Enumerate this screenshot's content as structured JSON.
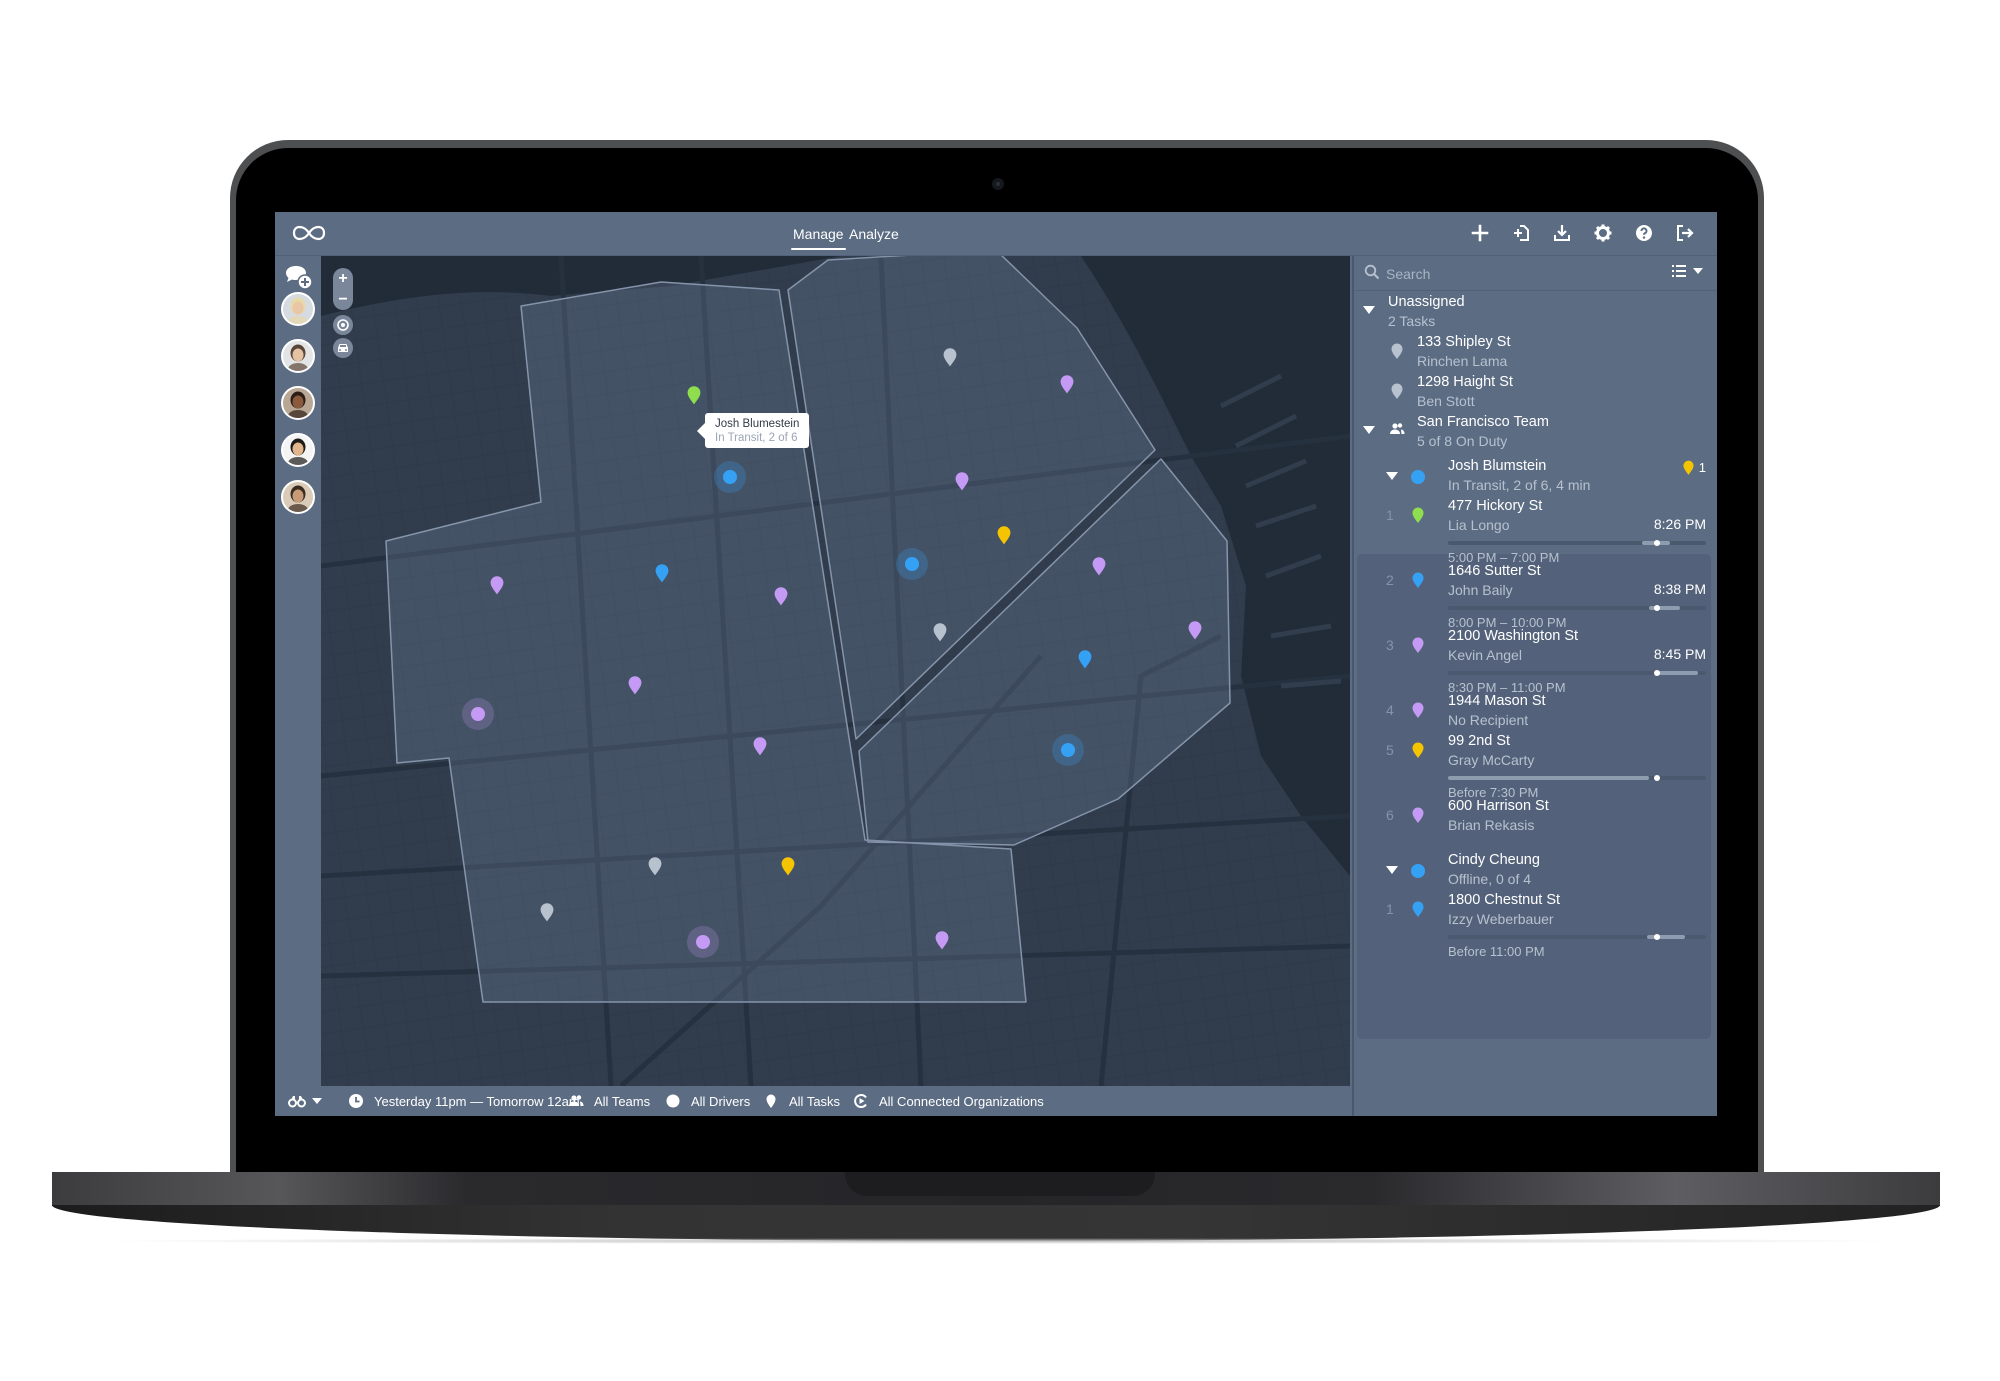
{
  "app": {
    "logo_icon": "infinity-icon",
    "nav_tabs": [
      {
        "label": "Manage",
        "active": true
      },
      {
        "label": "Analyze",
        "active": false
      }
    ],
    "top_actions": [
      {
        "name": "add-task-button",
        "icon": "plus-icon"
      },
      {
        "name": "import-button",
        "icon": "import-icon"
      },
      {
        "name": "download-button",
        "icon": "download-icon"
      },
      {
        "name": "settings-button",
        "icon": "gear-icon"
      },
      {
        "name": "help-button",
        "icon": "question-icon"
      },
      {
        "name": "logout-button",
        "icon": "logout-icon"
      }
    ]
  },
  "leftbar": {
    "chat_icon": "chat-add-icon",
    "avatars": [
      {
        "name": "driver-avatar-1",
        "skin": "#e9c6a6",
        "hair": "#e8d9a8",
        "bg": "#d5dbe0"
      },
      {
        "name": "driver-avatar-2",
        "skin": "#e6c2a4",
        "hair": "#5a4636",
        "bg": "#e3e4e6"
      },
      {
        "name": "driver-avatar-3",
        "skin": "#8a5a3e",
        "hair": "#2c1d15",
        "bg": "#b8a794"
      },
      {
        "name": "driver-avatar-4",
        "skin": "#e2b68c",
        "hair": "#1d1a17",
        "bg": "#f4f4f4"
      },
      {
        "name": "driver-avatar-5",
        "skin": "#c79a78",
        "hair": "#3b2a20",
        "bg": "#d9cbb8"
      }
    ]
  },
  "map": {
    "controls": {
      "zoom_in": "+",
      "zoom_out": "−",
      "locate_icon": "target-icon",
      "vehicle_icon": "car-icon"
    },
    "tooltip": {
      "name": "Josh Blumestein",
      "status": "In Transit, 2 of 6"
    },
    "colors": {
      "blue": "#35a1f5",
      "purple": "#c49af5",
      "green": "#8fde4e",
      "yellow": "#f5c400",
      "gray": "#b8c2cf"
    },
    "pins": [
      {
        "type": "pin",
        "color": "gray"
      },
      {
        "type": "pin",
        "color": "purple"
      },
      {
        "type": "pin",
        "color": "green"
      },
      {
        "type": "driver",
        "color": "blue"
      },
      {
        "type": "pin",
        "color": "purple"
      },
      {
        "type": "pin",
        "color": "yellow"
      },
      {
        "type": "driver",
        "color": "blue"
      },
      {
        "type": "pin",
        "color": "purple"
      },
      {
        "type": "pin",
        "color": "purple"
      },
      {
        "type": "pin",
        "color": "blue"
      },
      {
        "type": "pin",
        "color": "purple"
      },
      {
        "type": "pin",
        "color": "gray"
      },
      {
        "type": "pin",
        "color": "purple"
      },
      {
        "type": "pin",
        "color": "blue"
      },
      {
        "type": "pin",
        "color": "purple"
      },
      {
        "type": "driver",
        "color": "purple"
      },
      {
        "type": "pin",
        "color": "purple"
      },
      {
        "type": "driver",
        "color": "blue"
      },
      {
        "type": "pin",
        "color": "gray"
      },
      {
        "type": "pin",
        "color": "yellow"
      },
      {
        "type": "pin",
        "color": "gray"
      },
      {
        "type": "driver",
        "color": "purple"
      },
      {
        "type": "pin",
        "color": "purple"
      }
    ]
  },
  "bottombar": {
    "view_icon": "binoculars-icon",
    "items": [
      {
        "icon": "clock-icon",
        "label": "Yesterday 11pm — Tomorrow 12am"
      },
      {
        "icon": "team-icon",
        "label": "All Teams"
      },
      {
        "icon": "driver-dot-icon",
        "label": "All Drivers"
      },
      {
        "icon": "pin-icon",
        "label": "All Tasks"
      },
      {
        "icon": "org-icon",
        "label": "All Connected Organizations"
      }
    ]
  },
  "panel": {
    "search": {
      "placeholder": "Search",
      "value": ""
    },
    "unassigned": {
      "title": "Unassigned",
      "subtitle": "2 Tasks",
      "tasks": [
        {
          "address": "133 Shipley St",
          "recipient": "Rinchen Lama",
          "color": "gray"
        },
        {
          "address": "1298 Haight St",
          "recipient": "Ben Stott",
          "color": "gray"
        }
      ]
    },
    "team": {
      "title": "San Francisco Team",
      "subtitle": "5 of 8 On Duty"
    },
    "drivers": [
      {
        "name": "Josh Blumstein",
        "status": "In Transit, 2 of 6, 4 min",
        "color": "blue",
        "alert_count": "1",
        "tasks": [
          {
            "num": "1",
            "address": "477 Hickory St",
            "recipient": "Lia Longo",
            "eta": "8:26 PM",
            "window": "5:00 PM – 7:00 PM",
            "color": "green",
            "win_start": 0.75,
            "win_end": 0.86,
            "now": 0.81
          },
          {
            "num": "2",
            "address": "1646 Sutter St",
            "recipient": "John Baily",
            "eta": "8:38 PM",
            "window": "8:00 PM – 10:00 PM",
            "color": "blue",
            "win_start": 0.78,
            "win_end": 0.9,
            "now": 0.81
          },
          {
            "num": "3",
            "address": "2100 Washington St",
            "recipient": "Kevin Angel",
            "eta": "8:45 PM",
            "window": "8:30 PM – 11:00 PM",
            "color": "purple",
            "win_start": 0.81,
            "win_end": 0.97,
            "now": 0.81
          },
          {
            "num": "4",
            "address": "1944 Mason St",
            "recipient": "No Recipient",
            "eta": "",
            "window": "",
            "color": "purple"
          },
          {
            "num": "5",
            "address": "99 2nd St",
            "recipient": "Gray McCarty",
            "eta": "",
            "window": "Before 7:30 PM",
            "color": "yellow",
            "win_start": 0.0,
            "win_end": 0.78,
            "now": 0.81
          },
          {
            "num": "6",
            "address": "600 Harrison St",
            "recipient": "Brian Rekasis",
            "eta": "",
            "window": "",
            "color": "purple"
          }
        ]
      },
      {
        "name": "Cindy Cheung",
        "status": "Offline, 0 of 4",
        "color": "blue",
        "tasks": [
          {
            "num": "1",
            "address": "1800 Chestnut St",
            "recipient": "Izzy Weberbauer",
            "eta": "",
            "window": "Before 11:00 PM",
            "color": "blue",
            "win_start": 0.77,
            "win_end": 0.92,
            "now": 0.81
          }
        ]
      }
    ]
  }
}
